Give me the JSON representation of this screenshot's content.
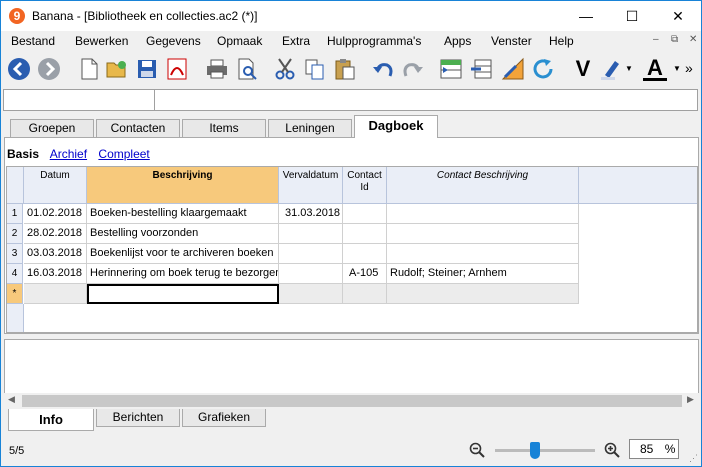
{
  "window": {
    "title": "Banana - [Bibliotheek en collecties.ac2 (*)]",
    "app_icon": "9",
    "min": "—",
    "max": "☐",
    "close": "✕"
  },
  "menu": [
    "Bestand",
    "Bewerken",
    "Gegevens",
    "Opmaak",
    "Extra",
    "Hulpprogramma's",
    "Apps",
    "Venster",
    "Help"
  ],
  "mdi": {
    "min": "–",
    "restore": "⧉",
    "close": "✕"
  },
  "toolbar": {
    "more": "»",
    "bold_v": "V",
    "font_a": "A"
  },
  "tabs": [
    "Groepen",
    "Contacten",
    "Items",
    "Leningen",
    "Dagboek"
  ],
  "views": [
    "Basis",
    "Archief",
    "Compleet"
  ],
  "columns": [
    {
      "label": "Datum"
    },
    {
      "label": "Beschrijving"
    },
    {
      "label": "Vervaldatum"
    },
    {
      "label": "Contact Id"
    },
    {
      "label": "Contact Beschrijving"
    }
  ],
  "rows": [
    {
      "num": "1",
      "cells": [
        "01.02.2018",
        "Boeken-bestelling klaargemaakt",
        "31.03.2018",
        "",
        ""
      ]
    },
    {
      "num": "2",
      "cells": [
        "28.02.2018",
        "Bestelling voorzonden",
        "",
        "",
        ""
      ]
    },
    {
      "num": "3",
      "cells": [
        "03.03.2018",
        "Boekenlijst voor te archiveren boeken",
        "",
        "",
        ""
      ]
    },
    {
      "num": "4",
      "cells": [
        "16.03.2018",
        "Herinnering om boek terug te bezorgen",
        "",
        "A-105",
        "Rudolf; Steiner; Arnhem"
      ]
    },
    {
      "num": "*",
      "cells": [
        "",
        "",
        "",
        "",
        ""
      ]
    }
  ],
  "bottom_tabs": [
    "Info",
    "Berichten",
    "Grafieken"
  ],
  "status": {
    "record": "5/5",
    "zoom": "85",
    "zoom_unit": "%",
    "zoom_level": 0.4
  },
  "colors": {
    "accent": "#1883d7",
    "header": "#eaeef7",
    "selected_header": "#f7c97c",
    "toolbar_blue": "#2a5db0"
  }
}
